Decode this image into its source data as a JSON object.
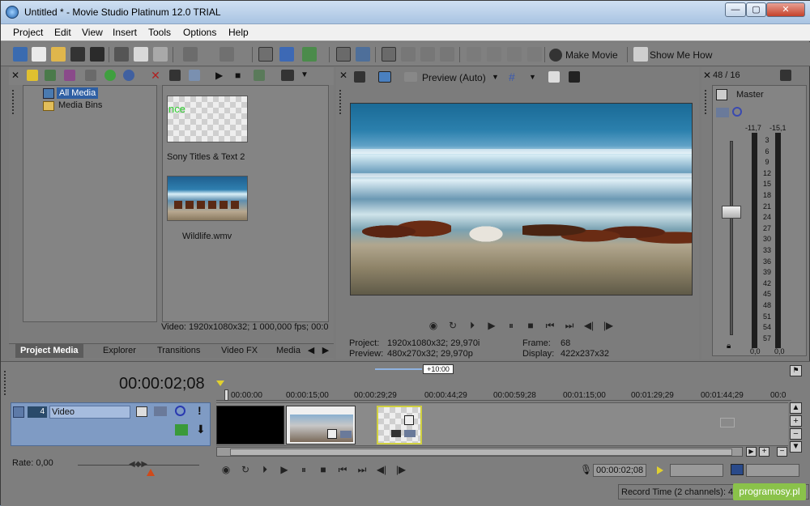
{
  "window": {
    "title": "Untitled * - Movie Studio Platinum 12.0 TRIAL",
    "btn_min": "—",
    "btn_max": "▢",
    "btn_close": "✕"
  },
  "menu": [
    "Project",
    "Edit",
    "View",
    "Insert",
    "Tools",
    "Options",
    "Help"
  ],
  "toolbar": {
    "make_movie": "Make Movie",
    "show_me_how": "Show Me How"
  },
  "media": {
    "tree": [
      "All Media",
      "Media Bins"
    ],
    "items": [
      {
        "thumb_text": "nce",
        "label": "Sony Titles & Text 2"
      },
      {
        "label": "Wildlife.wmv"
      }
    ],
    "info": "Video: 1920x1080x32; 1 000,000 fps; 00:0",
    "tabs": [
      "Project Media",
      "Explorer",
      "Transitions",
      "Video FX",
      "Media"
    ]
  },
  "preview": {
    "mode": "Preview (Auto)",
    "project_label": "Project:",
    "project_value": "1920x1080x32; 29,970i",
    "preview_label": "Preview:",
    "preview_value": "480x270x32; 29,970p",
    "frame_label": "Frame:",
    "frame_value": "68",
    "display_label": "Display:",
    "display_value": "422x237x32"
  },
  "mixer": {
    "channels": "48 / 16",
    "master": "Master",
    "peak_left": "-11,7",
    "peak_right": "-15,1",
    "scale": [
      "3",
      "6",
      "9",
      "12",
      "15",
      "18",
      "21",
      "24",
      "27",
      "30",
      "33",
      "36",
      "39",
      "42",
      "45",
      "48",
      "51",
      "54",
      "57"
    ],
    "val_left": "0,0",
    "val_right": "0,0",
    "lock_icon": "lock-icon"
  },
  "timeline": {
    "timecode": "00:00:02;08",
    "track_number": "4",
    "track_name": "Video",
    "rate": "Rate: 0,00",
    "marker": "+10:00",
    "ruler": [
      "00:00:00",
      "00:00:15;00",
      "00:00:29;29",
      "00:00:44;29",
      "00:00:59;28",
      "00:01:15;00",
      "00:01:29;29",
      "00:01:44;29",
      "00:0"
    ],
    "end_timecode": "00:00:02;08"
  },
  "status": {
    "record_time": "Record Time (2 channels): 42",
    "watermark": "programosy.pl"
  },
  "colors": {
    "accent": "#7fa8d8",
    "track_header": "#7f9bc4",
    "watermark_bg": "#8ac24a"
  }
}
